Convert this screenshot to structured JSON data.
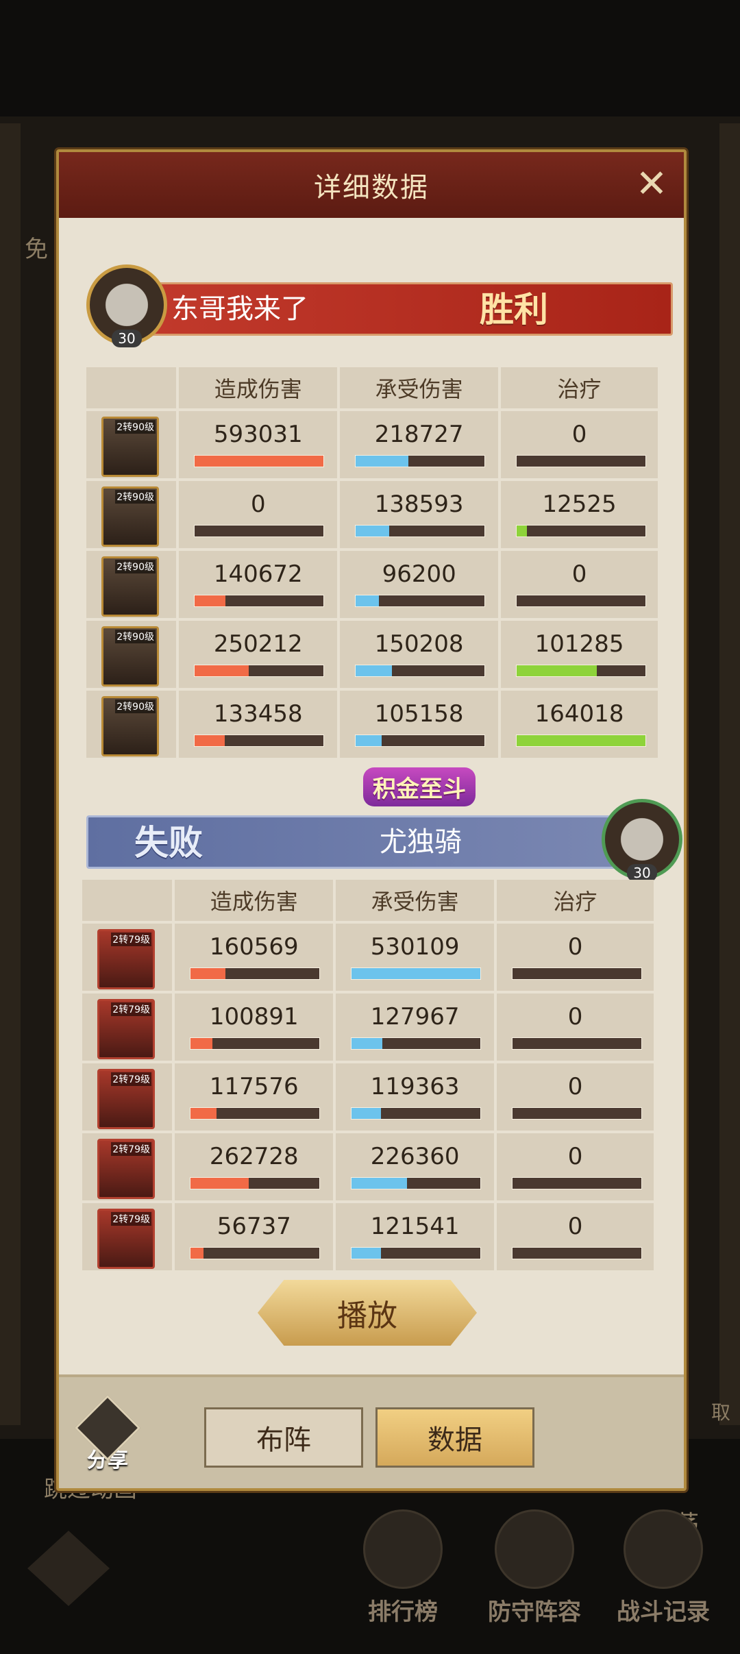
{
  "dialog": {
    "title": "详细数据"
  },
  "team_a": {
    "name": "东哥我来了",
    "result": "胜利",
    "level": "30"
  },
  "team_b": {
    "name": "尤独骑",
    "result": "失败",
    "level": "30",
    "title_badge": "积金至斗"
  },
  "headers": [
    "造成伤害",
    "承受伤害",
    "治疗"
  ],
  "team_a_rows": [
    {
      "tag": "2转90级",
      "dealt": "593031",
      "taken": "218727",
      "heal": "0",
      "dealt_frac": 1.0,
      "taken_frac": 0.41,
      "heal_frac": 0.0
    },
    {
      "tag": "2转90级",
      "dealt": "0",
      "taken": "138593",
      "heal": "12525",
      "dealt_frac": 0.0,
      "taken_frac": 0.26,
      "heal_frac": 0.08
    },
    {
      "tag": "2转90级",
      "dealt": "140672",
      "taken": "96200",
      "heal": "0",
      "dealt_frac": 0.24,
      "taken_frac": 0.18,
      "heal_frac": 0.0
    },
    {
      "tag": "2转90级",
      "dealt": "250212",
      "taken": "150208",
      "heal": "101285",
      "dealt_frac": 0.42,
      "taken_frac": 0.28,
      "heal_frac": 0.62
    },
    {
      "tag": "2转90级",
      "dealt": "133458",
      "taken": "105158",
      "heal": "164018",
      "dealt_frac": 0.23,
      "taken_frac": 0.2,
      "heal_frac": 1.0
    }
  ],
  "team_b_rows": [
    {
      "tag": "2转79级",
      "dealt": "160569",
      "taken": "530109",
      "heal": "0",
      "dealt_frac": 0.27,
      "taken_frac": 1.0,
      "heal_frac": 0.0
    },
    {
      "tag": "2转79级",
      "dealt": "100891",
      "taken": "127967",
      "heal": "0",
      "dealt_frac": 0.17,
      "taken_frac": 0.24,
      "heal_frac": 0.0
    },
    {
      "tag": "2转79级",
      "dealt": "117576",
      "taken": "119363",
      "heal": "0",
      "dealt_frac": 0.2,
      "taken_frac": 0.23,
      "heal_frac": 0.0
    },
    {
      "tag": "2转79级",
      "dealt": "262728",
      "taken": "226360",
      "heal": "0",
      "dealt_frac": 0.45,
      "taken_frac": 0.43,
      "heal_frac": 0.0
    },
    {
      "tag": "2转79级",
      "dealt": "56737",
      "taken": "121541",
      "heal": "0",
      "dealt_frac": 0.1,
      "taken_frac": 0.23,
      "heal_frac": 0.0
    }
  ],
  "buttons": {
    "play": "播放",
    "lineup": "布阵",
    "data": "数据",
    "share": "分享"
  },
  "background": {
    "side_left": "免",
    "side_right": "取",
    "skip": "跳过动画",
    "sweep": "扫荡",
    "rank": "排行榜",
    "defense": "防守阵容",
    "battle_log": "战斗记录"
  },
  "colors": {
    "damage": "#f16a46",
    "taken": "#6cc3ec",
    "heal": "#8ed33a"
  }
}
